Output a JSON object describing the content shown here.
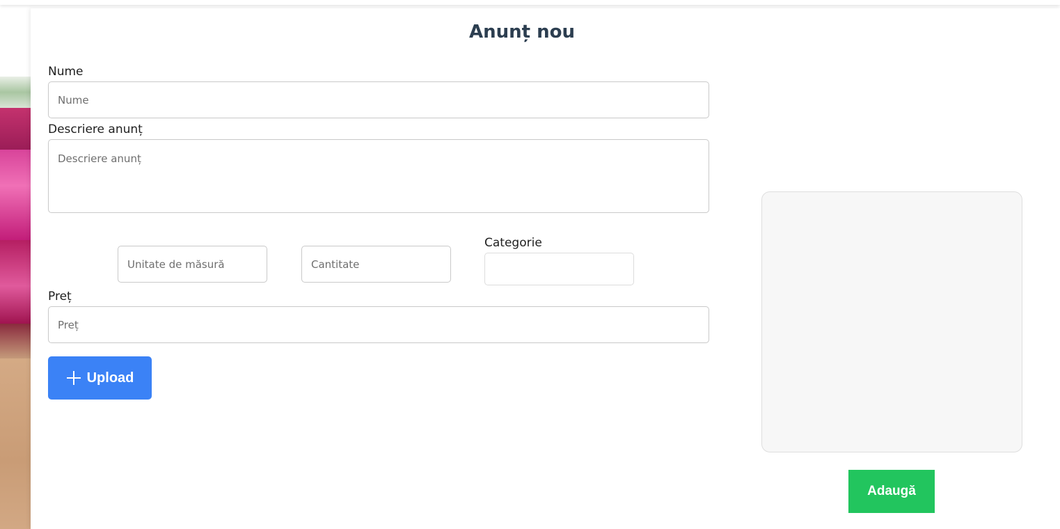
{
  "form": {
    "title": "Anunț nou",
    "name": {
      "label": "Nume",
      "placeholder": "Nume",
      "value": ""
    },
    "description": {
      "label": "Descriere anunț",
      "placeholder": "Descriere anunț",
      "value": ""
    },
    "unit": {
      "placeholder": "Unitate de măsură",
      "value": ""
    },
    "quantity": {
      "placeholder": "Cantitate",
      "value": ""
    },
    "category": {
      "label": "Categorie",
      "selected": ""
    },
    "price": {
      "label": "Preț",
      "placeholder": "Preț",
      "value": ""
    },
    "upload": {
      "label": "Upload",
      "icon": "plus-icon"
    },
    "submit": {
      "label": "Adaugă"
    }
  },
  "colors": {
    "title": "#2c3e50",
    "upload_button": "#3b82f6",
    "submit_button": "#22c55e",
    "preview_background": "#f7f7f7"
  }
}
